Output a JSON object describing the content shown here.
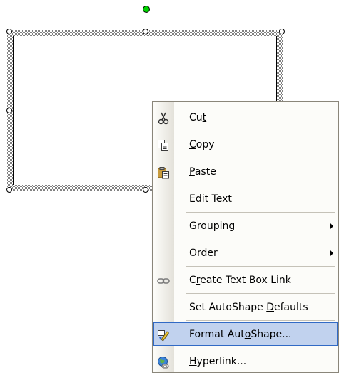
{
  "window": {
    "title": ""
  },
  "context_menu": {
    "items": [
      {
        "label": "Cut",
        "pre": "Cu",
        "mnemonic": "t",
        "post": "",
        "icon": "scissors-icon",
        "submenu": false,
        "separator_after": true,
        "highlighted": false
      },
      {
        "label": "Copy",
        "pre": "",
        "mnemonic": "C",
        "post": "opy",
        "icon": "copy-icon",
        "submenu": false,
        "separator_after": false,
        "highlighted": false
      },
      {
        "label": "Paste",
        "pre": "",
        "mnemonic": "P",
        "post": "aste",
        "icon": "paste-icon",
        "submenu": false,
        "separator_after": true,
        "highlighted": false
      },
      {
        "label": "Edit Text",
        "pre": "Edit Te",
        "mnemonic": "x",
        "post": "t",
        "icon": "",
        "submenu": false,
        "separator_after": true,
        "highlighted": false
      },
      {
        "label": "Grouping",
        "pre": "",
        "mnemonic": "G",
        "post": "rouping",
        "icon": "",
        "submenu": true,
        "separator_after": false,
        "highlighted": false
      },
      {
        "label": "Order",
        "pre": "O",
        "mnemonic": "r",
        "post": "der",
        "icon": "",
        "submenu": true,
        "separator_after": true,
        "highlighted": false
      },
      {
        "label": "Create Text Box Link",
        "pre": "C",
        "mnemonic": "r",
        "post": "eate Text Box Link",
        "icon": "chain-link-icon",
        "submenu": false,
        "separator_after": true,
        "highlighted": false
      },
      {
        "label": "Set AutoShape Defaults",
        "pre": "Set AutoShape ",
        "mnemonic": "D",
        "post": "efaults",
        "icon": "",
        "submenu": false,
        "separator_after": true,
        "highlighted": false
      },
      {
        "label": "Format AutoShape...",
        "pre": "Format Aut",
        "mnemonic": "o",
        "post": "Shape...",
        "icon": "format-shape-icon",
        "submenu": false,
        "separator_after": false,
        "highlighted": true
      },
      {
        "label": "Hyperlink...",
        "pre": "",
        "mnemonic": "H",
        "post": "yperlink...",
        "icon": "hyperlink-globe-icon",
        "submenu": false,
        "separator_after": false,
        "highlighted": false
      }
    ]
  },
  "colors": {
    "highlight_fill": "#c1d2ee",
    "highlight_border": "#316ac5",
    "rotate_handle": "#00d200",
    "menu_background": "#fcfcf9"
  }
}
